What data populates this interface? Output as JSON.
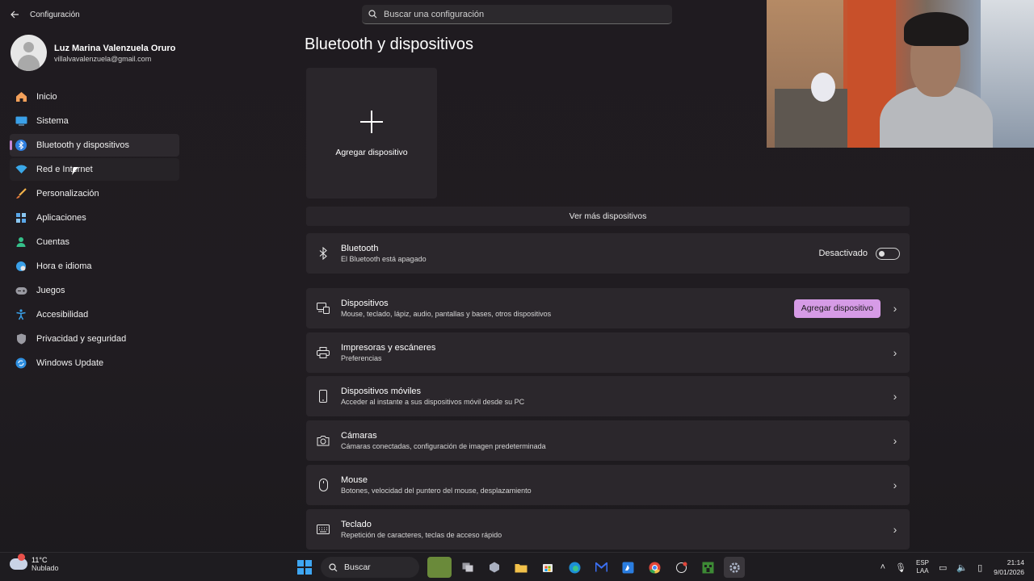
{
  "window": {
    "app_title": "Configuración",
    "search_placeholder": "Buscar una configuración"
  },
  "profile": {
    "name": "Luz Marina Valenzuela Oruro",
    "email": "villalvavalenzuela@gmail.com"
  },
  "nav": {
    "items": [
      {
        "label": "Inicio",
        "icon": "home-icon"
      },
      {
        "label": "Sistema",
        "icon": "system-icon"
      },
      {
        "label": "Bluetooth y dispositivos",
        "icon": "bluetooth-icon"
      },
      {
        "label": "Red e Internet",
        "icon": "wifi-icon"
      },
      {
        "label": "Personalización",
        "icon": "brush-icon"
      },
      {
        "label": "Aplicaciones",
        "icon": "apps-icon"
      },
      {
        "label": "Cuentas",
        "icon": "account-icon"
      },
      {
        "label": "Hora e idioma",
        "icon": "globe-icon"
      },
      {
        "label": "Juegos",
        "icon": "gamepad-icon"
      },
      {
        "label": "Accesibilidad",
        "icon": "accessibility-icon"
      },
      {
        "label": "Privacidad y seguridad",
        "icon": "shield-icon"
      },
      {
        "label": "Windows Update",
        "icon": "update-icon"
      }
    ],
    "active_index": 2
  },
  "main": {
    "title": "Bluetooth y dispositivos",
    "add_tile_label": "Agregar dispositivo",
    "more_devices": "Ver más dispositivos",
    "bluetooth": {
      "title": "Bluetooth",
      "subtitle": "El Bluetooth está apagado",
      "toggle_label": "Desactivado",
      "toggle_on": false
    },
    "rows": [
      {
        "title": "Dispositivos",
        "subtitle": "Mouse, teclado, lápiz, audio, pantallas y bases, otros dispositivos",
        "icon": "devices-icon",
        "button": "Agregar dispositivo"
      },
      {
        "title": "Impresoras y escáneres",
        "subtitle": "Preferencias",
        "icon": "printer-icon"
      },
      {
        "title": "Dispositivos móviles",
        "subtitle": "Acceder al instante a sus dispositivos móvil desde su PC",
        "icon": "phone-icon"
      },
      {
        "title": "Cámaras",
        "subtitle": "Cámaras conectadas, configuración de imagen predeterminada",
        "icon": "camera-icon"
      },
      {
        "title": "Mouse",
        "subtitle": "Botones, velocidad del puntero del mouse, desplazamiento",
        "icon": "mouse-icon"
      },
      {
        "title": "Teclado",
        "subtitle": "Repetición de caracteres, teclas de acceso rápido",
        "icon": "keyboard-icon"
      }
    ]
  },
  "taskbar": {
    "weather_temp": "11°C",
    "weather_desc": "Nublado",
    "search_label": "Buscar",
    "lang_line1": "ESP",
    "lang_line2": "LAA",
    "time": "21:14",
    "date": "9/01/2026"
  },
  "colors": {
    "accent": "#d69be6",
    "background": "#1f1b20",
    "card": "#2b272c"
  }
}
